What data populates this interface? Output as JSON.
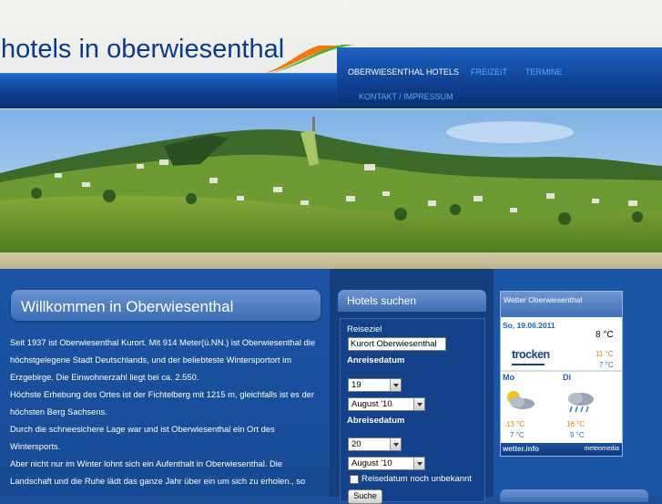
{
  "header": {
    "site_title": "hotels in oberwiesenthal",
    "nav": [
      {
        "label": "OBERWIESENTHAL HOTELS"
      },
      {
        "label": "FREIZEIT"
      },
      {
        "label": "TERMINE"
      },
      {
        "label": "KONTAKT / IMPRESSUM"
      }
    ]
  },
  "welcome": {
    "title": "Willkommen in Oberwiesenthal",
    "paragraphs": [
      "Seit 1937 ist Oberwiesenthal Kurort. Mit 914 Meter(ü.NN.) ist Oberwiesenthal die",
      "höchstgelegene Stadt Deutschlands, und der beliebteste Wintersportort im",
      "Erzgebirge. Die Einwohnerzahl liegt bei ca. 2.550.",
      "Höchste Erhebung des Ortes ist der Fichtelberg mit 1215 m, gleichfalls ist es der",
      "höchsten Berg Sachsens.",
      "Durch die schneesichere Lage war und ist Oberwiesenthal ein Ort des",
      "Wintersports.",
      "Aber nicht nur im Winter lohnt sich ein Aufenthalt in  Oberwiesenthal.  Die",
      "Landschaft und die Ruhe lädt das ganze Jahr über ein um sich zu erholen., so"
    ]
  },
  "hotel_search": {
    "title": "Hotels suchen",
    "reiseziel_label": "Reiseziel",
    "reiseziel_value": "Kurort Oberwiesenthal",
    "anreise_label": "Anreisedatum",
    "anreise_day": "19",
    "anreise_month": "August '10",
    "abreise_label": "Abreisedatum",
    "abreise_day": "20",
    "abreise_month": "August '10",
    "unknown_label": "Reisedatum noch unbekannt",
    "submit_label": "Suche"
  },
  "weather": {
    "title": "Wetter Oberwiesenthal",
    "date": "So, 19.06.2011",
    "current_temp": "8 °C",
    "condition": "trocken",
    "today_high": "11 °C",
    "today_low": "7 °C",
    "days": [
      {
        "name": "Mo",
        "high": "13 °C",
        "low": "7 °C",
        "icon": "sun-cloud-icon"
      },
      {
        "name": "Di",
        "high": "16 °C",
        "low": "9 °C",
        "icon": "rain-cloud-icon"
      }
    ],
    "footer_left": "wetter.info",
    "footer_right": "meteomedia",
    "colors": {
      "high": "#e87c10",
      "low": "#2a6fd0"
    }
  }
}
